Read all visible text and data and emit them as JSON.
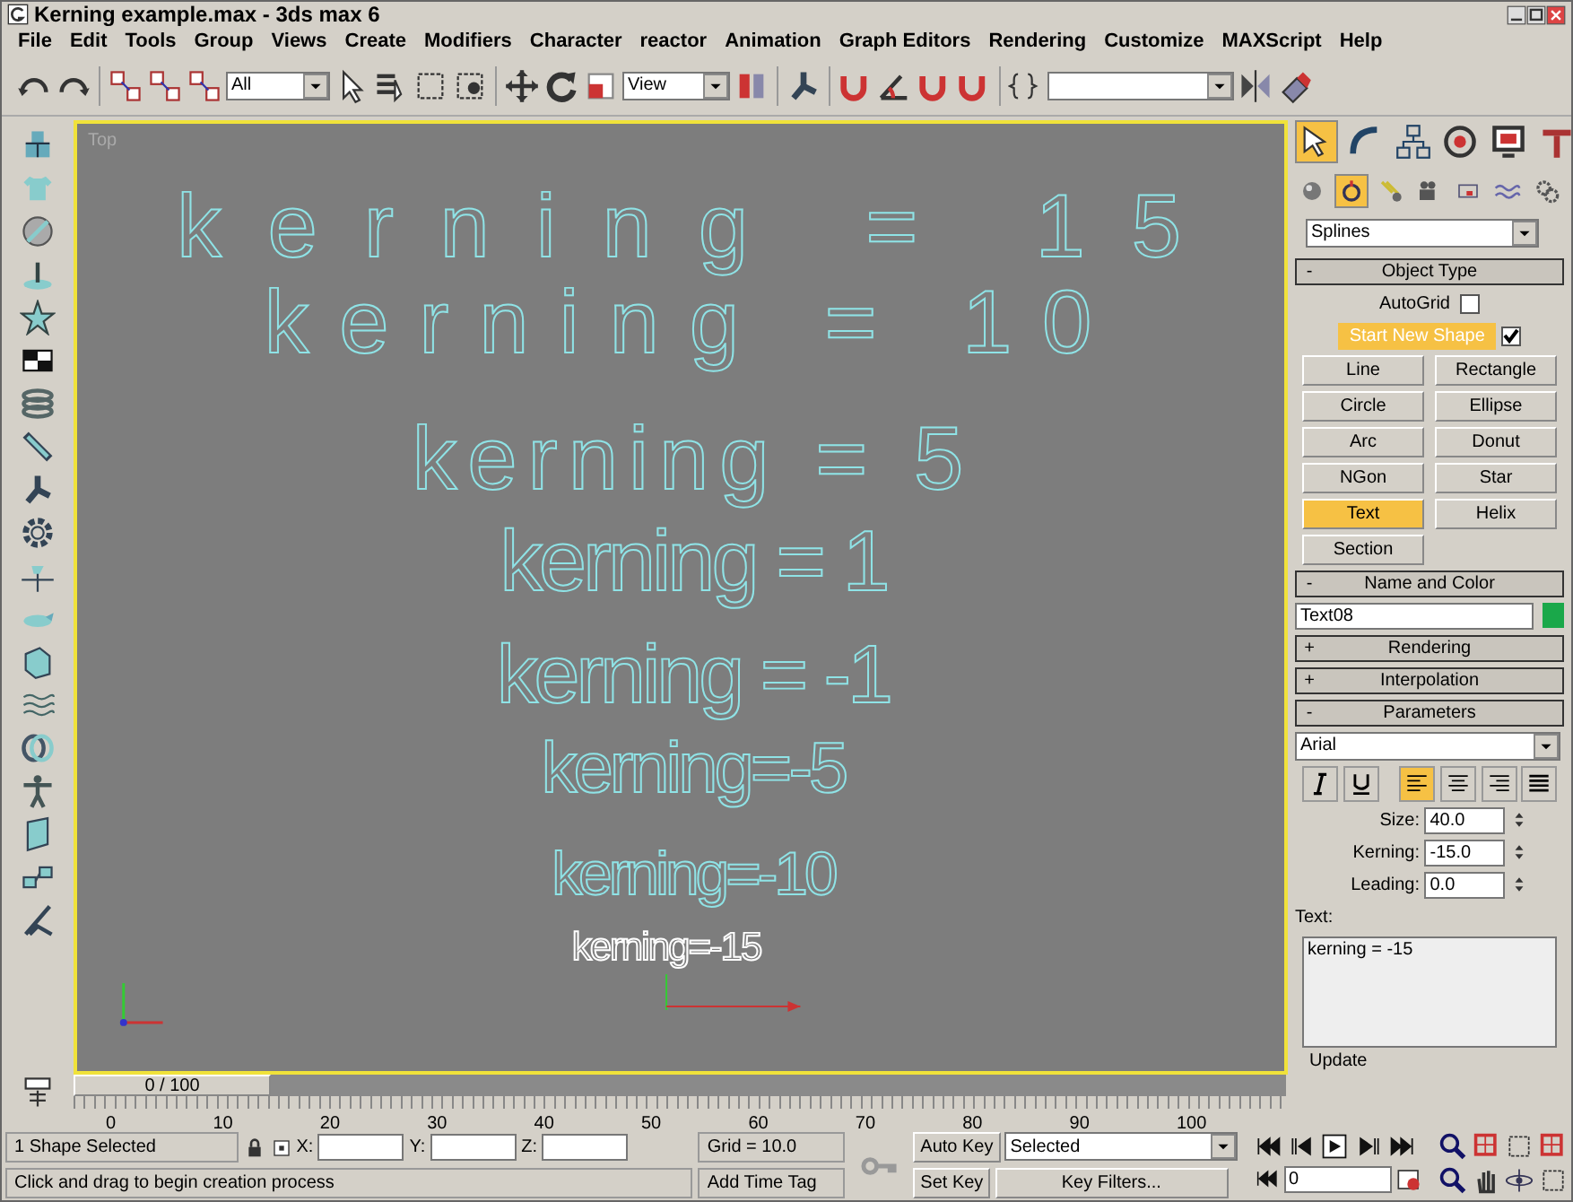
{
  "window": {
    "title": "Kerning example.max - 3ds max 6"
  },
  "menu": [
    "File",
    "Edit",
    "Tools",
    "Group",
    "Views",
    "Create",
    "Modifiers",
    "Character",
    "reactor",
    "Animation",
    "Graph Editors",
    "Rendering",
    "Customize",
    "MAXScript",
    "Help"
  ],
  "toolbar": {
    "selection_filter": "All",
    "reference_coord": "View"
  },
  "viewport": {
    "label": "Top",
    "texts": [
      "kerning = 15",
      "kerning = 10",
      "kerning = 5",
      "kerning = 1",
      "kerning = -1",
      "kerning=-5",
      "kerning=-10",
      "kerning=-15"
    ]
  },
  "command_panel": {
    "tabs": [
      {
        "selected": true
      },
      {
        "selected": false
      },
      {
        "selected": false
      },
      {
        "selected": false
      },
      {
        "selected": false
      },
      {
        "selected": false
      }
    ],
    "categories": [
      {
        "selected": false
      },
      {
        "selected": true
      },
      {
        "selected": false
      },
      {
        "selected": false
      },
      {
        "selected": false
      },
      {
        "selected": false
      },
      {
        "selected": false
      }
    ],
    "category": "Splines",
    "object_type": {
      "sign": "-",
      "title": "Object Type",
      "autogrid": {
        "label": "AutoGrid",
        "checked": false
      },
      "start_new_shape": {
        "label": "Start New Shape",
        "checked": true
      },
      "buttons": [
        {
          "label": "Line",
          "selected": false
        },
        {
          "label": "Rectangle",
          "selected": false
        },
        {
          "label": "Circle",
          "selected": false
        },
        {
          "label": "Ellipse",
          "selected": false
        },
        {
          "label": "Arc",
          "selected": false
        },
        {
          "label": "Donut",
          "selected": false
        },
        {
          "label": "NGon",
          "selected": false
        },
        {
          "label": "Star",
          "selected": false
        },
        {
          "label": "Text",
          "selected": true
        },
        {
          "label": "Helix",
          "selected": false
        },
        {
          "label": "Section",
          "selected": false
        }
      ]
    },
    "name_and_color": {
      "sign": "-",
      "title": "Name and Color",
      "name": "Text08",
      "color": "#1aa84a"
    },
    "collapsed": [
      {
        "sign": "+",
        "title": "Rendering"
      },
      {
        "sign": "+",
        "title": "Interpolation"
      }
    ],
    "parameters": {
      "sign": "-",
      "title": "Parameters",
      "font": "Arial",
      "styles": [
        {
          "kind": "italic",
          "selected": false
        },
        {
          "kind": "underline",
          "selected": false
        },
        {
          "kind": "align-left",
          "selected": true
        },
        {
          "kind": "align-center",
          "selected": false
        },
        {
          "kind": "align-right",
          "selected": false
        },
        {
          "kind": "justify",
          "selected": false
        }
      ],
      "fields": [
        {
          "label": "Size:",
          "value": "40.0"
        },
        {
          "label": "Kerning:",
          "value": "-15.0"
        },
        {
          "label": "Leading:",
          "value": "0.0"
        }
      ],
      "text_label": "Text:",
      "text": "kerning = -15",
      "update": "Update"
    }
  },
  "timeline": {
    "slider": "0 / 100",
    "level": 0,
    "ticks": [
      "0",
      "10",
      "20",
      "30",
      "40",
      "50",
      "60",
      "70",
      "80",
      "90",
      "100"
    ]
  },
  "status": {
    "selection": "1 Shape Selected",
    "prompt": "Click and drag to begin creation process",
    "x_label": "X:",
    "y_label": "Y:",
    "z_label": "Z:",
    "grid": "Grid = 10.0",
    "add_time_tag": "Add Time Tag",
    "auto_key": "Auto Key",
    "set_key": "Set Key",
    "key_mode": "Selected",
    "key_filters": "Key Filters...",
    "frame": "0"
  }
}
